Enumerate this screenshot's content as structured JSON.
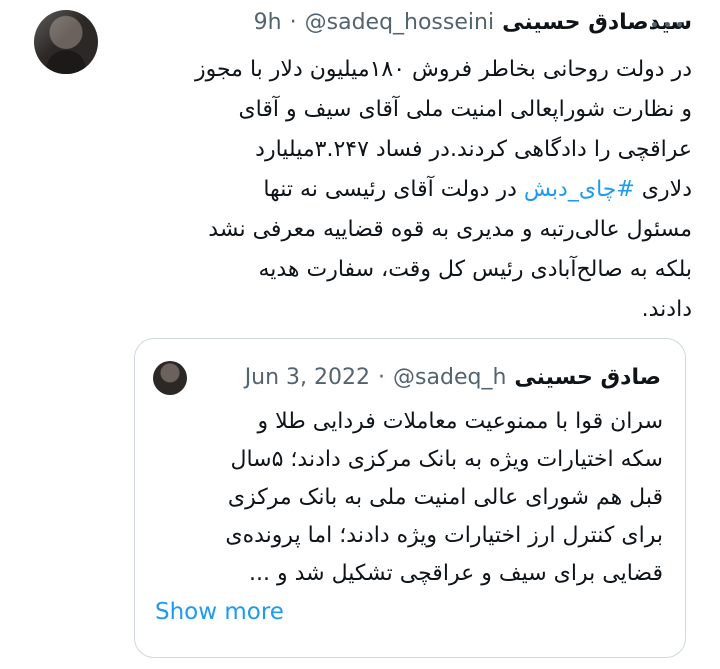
{
  "tweet": {
    "author_name": "سیدصادق حسینی",
    "handle": "@sadeq_hosseini",
    "separator": "·",
    "time": "9h",
    "text_lines": [
      "در دولت روحانی بخاطر فروش ۱۸۰میلیون دلار با مجوز",
      "و نظارت شوراپعالی امنیت ملی آقای سیف و آقای",
      "عراقچی را دادگاهی کردند.در فساد ۳.۲۴۷میلیارد",
      {
        "before": "دلاری ",
        "hashtag": "#چای_دبش",
        "after": " در دولت آقای رئیسی نه تنها"
      },
      "مسئول عالی‌رتبه و مدیری به قوه قضاییه معرفی نشد",
      "بلکه به صالح‌آبادی رئیس کل  وقت، سفارت هدیه",
      "دادند."
    ],
    "icons": {
      "avatar": "avatar-photo",
      "more": "more-icon"
    }
  },
  "quote": {
    "author_name": "صادق حسینی",
    "handle": "@sadeq_h",
    "separator": "·",
    "date": "Jun 3, 2022",
    "text_lines": [
      "سران قوا با ممنوعیت معاملات فردایی طلا و",
      "سکه اختیارات ویژه به بانک مرکزی دادند؛ ۵سال",
      "قبل هم شورای عالی امنیت ملی به بانک مرکزی",
      "برای کنترل ارز اختیارات ویژه دادند؛ اما پرونده‌ی",
      "قضایی برای سیف و عراقچی تشکیل شد و ..."
    ],
    "show_more": "Show more"
  },
  "colors": {
    "link": "#1d9bf0",
    "secondary": "#536471",
    "border": "#cfd9de"
  }
}
